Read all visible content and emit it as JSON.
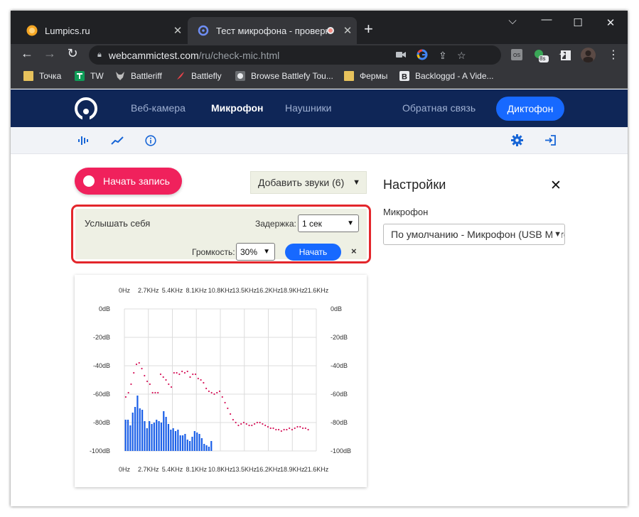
{
  "browser": {
    "tabs": [
      {
        "title": "Lumpics.ru",
        "close": "✕"
      },
      {
        "title": "Тест микрофона - проверка",
        "close": "✕"
      }
    ],
    "new_tab": "+",
    "window_controls": [
      "⌵",
      "—",
      "☐",
      "✕"
    ],
    "url_host": "webcammictest.com",
    "url_path": "/ru/check-mic.html",
    "extension_badge": "8s",
    "bookmarks": [
      {
        "label": "Точка",
        "icon": "folder-icon"
      },
      {
        "label": "TW",
        "icon": "tw-icon"
      },
      {
        "label": "Battleriff",
        "icon": "wolf-icon"
      },
      {
        "label": "Battlefly",
        "icon": "battlefly-icon"
      },
      {
        "label": "Browse Battlefy Tou...",
        "icon": "battlefy-icon"
      },
      {
        "label": "Фермы",
        "icon": "folder-icon"
      },
      {
        "label": "Backloggd - A Vide...",
        "icon": "backloggd-icon"
      }
    ]
  },
  "site": {
    "nav": {
      "webcam": "Веб-камера",
      "microphone": "Микрофон",
      "headphones": "Наушники",
      "feedback": "Обратная связь",
      "dictophone": "Диктофон"
    },
    "record_button": "Начать запись",
    "add_sounds": "Добавить звуки (6)",
    "hear_yourself": {
      "title": "Услышать себя",
      "delay_label": "Задержка:",
      "delay_value": "1 сек",
      "volume_label": "Громкость:",
      "volume_value": "30%",
      "start_button": "Начать",
      "close": "×"
    },
    "settings": {
      "title": "Настройки",
      "close": "✕",
      "microphone_label": "Микрофон",
      "microphone_value": "По умолчанию - Микрофон (USB Micro"
    }
  },
  "chart_data": {
    "type": "bar",
    "x_tick_labels": [
      "0Hz",
      "2.7KHz",
      "5.4KHz",
      "8.1KHz",
      "10.8KHz",
      "13.5KHz",
      "16.2KHz",
      "18.9KHz",
      "21.6KHz"
    ],
    "y_tick_labels": [
      "0dB",
      "-20dB",
      "-40dB",
      "-60dB",
      "-80dB",
      "-100dB"
    ],
    "ylim": [
      -100,
      0
    ],
    "xlim": [
      0,
      21.6
    ],
    "grid": true,
    "series": [
      {
        "kind": "bars",
        "color": "#1a5fe8",
        "values": [
          -78,
          -78,
          -82,
          -73,
          -69,
          -61,
          -70,
          -71,
          -79,
          -84,
          -79,
          -81,
          -80,
          -78,
          -79,
          -80,
          -72,
          -76,
          -81,
          -85,
          -84,
          -86,
          -85,
          -89,
          -89,
          -88,
          -92,
          -93,
          -90,
          -86,
          -87,
          -88,
          -91,
          -95,
          -96,
          -97,
          -93,
          -100,
          -100,
          -100
        ]
      },
      {
        "kind": "peak-dots",
        "color": "#d6185c",
        "values": [
          -62,
          -59,
          -53,
          -45,
          -39,
          -38,
          -42,
          -47,
          -51,
          -53,
          -59,
          -59,
          -59,
          -46,
          -48,
          -50,
          -53,
          -55,
          -45,
          -45,
          -46,
          -44,
          -45,
          -44,
          -48,
          -46,
          -46,
          -49,
          -50,
          -52,
          -56,
          -58,
          -59,
          -60,
          -59,
          -58,
          -62,
          -66,
          -70,
          -74,
          -78,
          -80,
          -82,
          -81,
          -80,
          -81,
          -82,
          -82,
          -81,
          -80,
          -80,
          -81,
          -82,
          -83,
          -84,
          -84,
          -85,
          -85,
          -86,
          -85,
          -85,
          -84,
          -85,
          -84,
          -83,
          -83,
          -84,
          -84,
          -85
        ]
      }
    ]
  }
}
